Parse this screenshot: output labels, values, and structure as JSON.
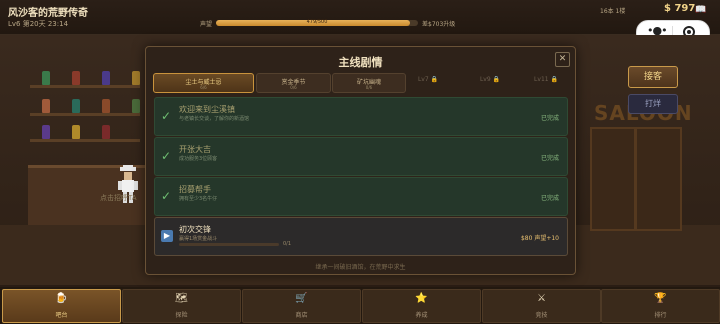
{
  "header": {
    "title": "风沙客的荒野传奇",
    "level_day": "Lv6 第20天 23:14",
    "reputation_label": "声望",
    "reputation_value": "479/500",
    "reputation_progress": 0.958,
    "upgrade_text": "差$703升级",
    "day_count": "16本 1楼",
    "money": "$ 797"
  },
  "scene": {
    "saloon_sign": "SALOON",
    "guest_button": "接客",
    "close_button": "打烊",
    "npc_hint": "点击招呼TA"
  },
  "modal": {
    "title": "主线剧情",
    "tabs": [
      {
        "label": "尘土与威士忌",
        "progress": "6/6",
        "state": "active"
      },
      {
        "label": "赏金季节",
        "progress": "0/6",
        "state": "normal"
      },
      {
        "label": "矿坑幽魂",
        "progress": "0/6",
        "state": "normal"
      },
      {
        "label": "Lv7 🔒",
        "progress": "",
        "state": "locked"
      },
      {
        "label": "Lv9 🔒",
        "progress": "",
        "state": "locked"
      },
      {
        "label": "Lv11 🔒",
        "progress": "",
        "state": "locked"
      }
    ],
    "quests": [
      {
        "title": "欢迎来到尘溪镇",
        "desc": "与老镇长交谈，了解你的新酒馆",
        "status": "已完成",
        "state": "done"
      },
      {
        "title": "开张大吉",
        "desc": "成功服务3位顾客",
        "status": "已完成",
        "state": "done"
      },
      {
        "title": "招募帮手",
        "desc": "拥有至少3名牛仔",
        "status": "已完成",
        "state": "done"
      },
      {
        "title": "初次交锋",
        "desc": "赢得1场赏金战斗",
        "progress": "0/1",
        "progress_value": 0,
        "reward": "$80 声望+10",
        "state": "active"
      }
    ],
    "footer": "继承一间破旧酒馆，在荒野中求生"
  },
  "nav": {
    "items": [
      {
        "label": "吧台",
        "icon": "beer-mug-icon",
        "glyph": "🍺",
        "active": true
      },
      {
        "label": "探险",
        "icon": "map-icon",
        "glyph": "🗺",
        "active": false
      },
      {
        "label": "商店",
        "icon": "cart-icon",
        "glyph": "🛒",
        "active": false
      },
      {
        "label": "养成",
        "icon": "star-icon",
        "glyph": "⭐",
        "active": false
      },
      {
        "label": "竞技",
        "icon": "crossed-swords-icon",
        "glyph": "⚔",
        "active": false
      },
      {
        "label": "排行",
        "icon": "trophy-icon",
        "glyph": "🏆",
        "active": false
      }
    ]
  }
}
